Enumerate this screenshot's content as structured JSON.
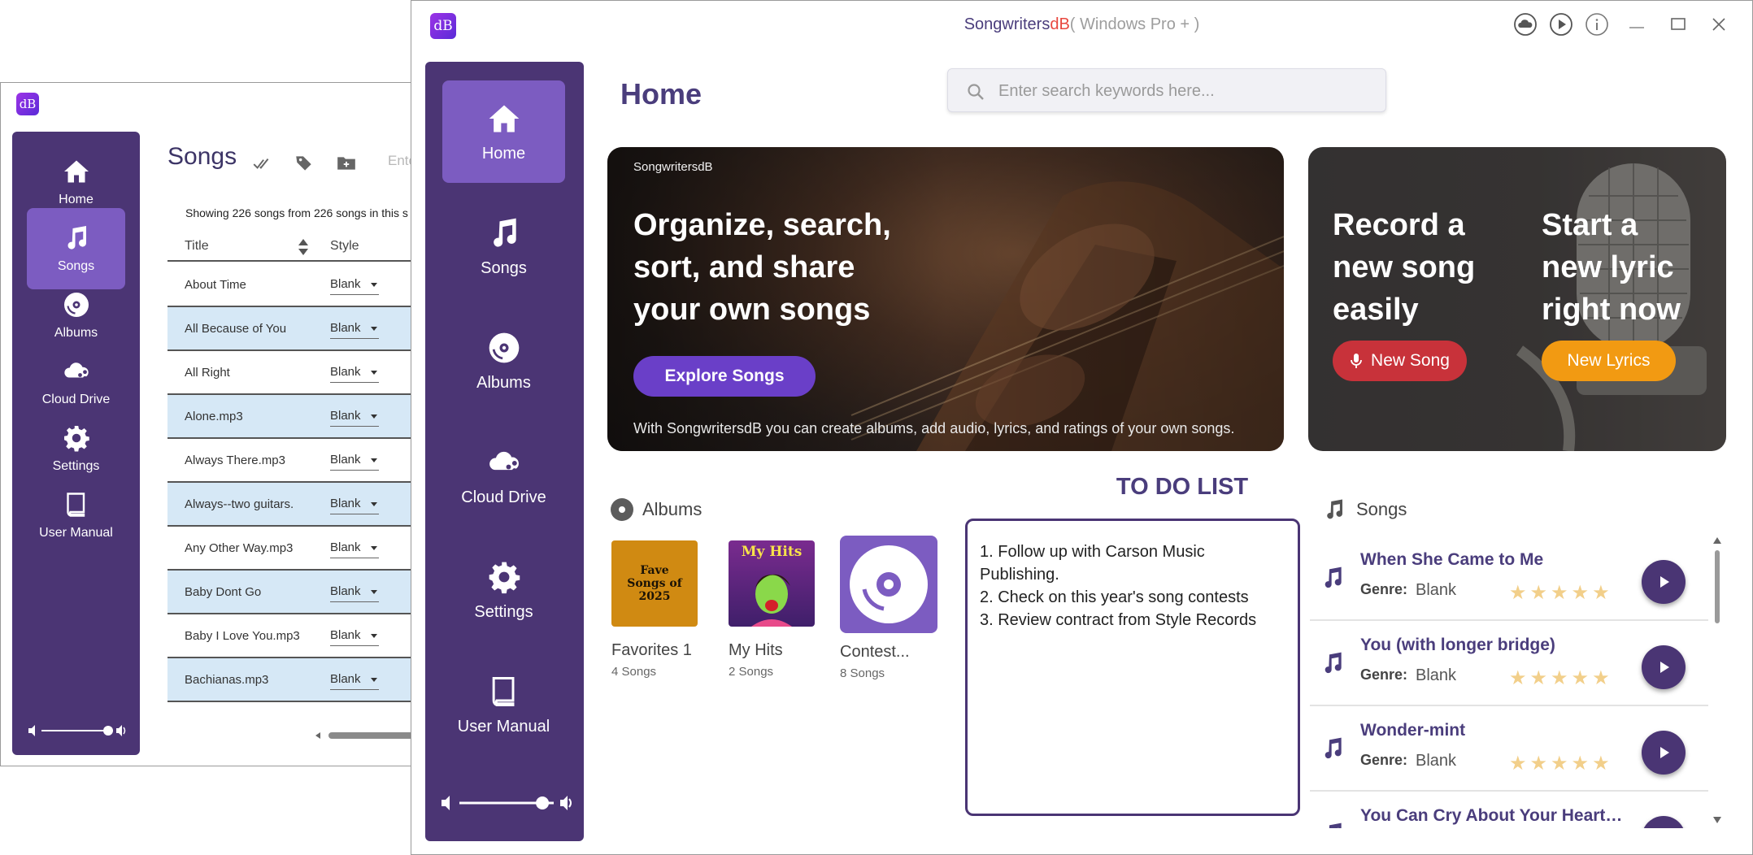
{
  "back_window": {
    "logo": "dB",
    "nav": [
      {
        "label": "Home",
        "icon": "home-icon"
      },
      {
        "label": "Songs",
        "icon": "music-note-icon"
      },
      {
        "label": "Albums",
        "icon": "disc-icon"
      },
      {
        "label": "Cloud Drive",
        "icon": "cloud-share-icon"
      },
      {
        "label": "Settings",
        "icon": "gear-icon"
      },
      {
        "label": "User Manual",
        "icon": "book-icon"
      }
    ],
    "active_nav": "Songs",
    "page_title": "Songs",
    "search_fragment": "Ente",
    "showing_text": "Showing 226 songs from 226 songs in this s",
    "columns": {
      "title": "Title",
      "style": "Style"
    },
    "rows": [
      {
        "title": "About Time",
        "style": "Blank"
      },
      {
        "title": "All Because of You",
        "style": "Blank"
      },
      {
        "title": "All Right",
        "style": "Blank"
      },
      {
        "title": "Alone.mp3",
        "style": "Blank"
      },
      {
        "title": "Always There.mp3",
        "style": "Blank"
      },
      {
        "title": "Always--two guitars.",
        "style": "Blank"
      },
      {
        "title": "Any Other Way.mp3",
        "style": "Blank"
      },
      {
        "title": "Baby Dont Go",
        "style": "Blank"
      },
      {
        "title": "Baby I Love You.mp3",
        "style": "Blank"
      },
      {
        "title": "Bachianas.mp3",
        "style": "Blank"
      }
    ]
  },
  "window": {
    "logo": "dB",
    "title_app": "Songwriters",
    "title_db": "dB",
    "title_edition": "( Windows Pro + )"
  },
  "sidebar": {
    "items": [
      {
        "label": "Home",
        "icon": "home-icon"
      },
      {
        "label": "Songs",
        "icon": "music-note-icon"
      },
      {
        "label": "Albums",
        "icon": "disc-icon"
      },
      {
        "label": "Cloud Drive",
        "icon": "cloud-share-icon"
      },
      {
        "label": "Settings",
        "icon": "gear-icon"
      },
      {
        "label": "User Manual",
        "icon": "book-icon"
      }
    ],
    "active": "Home",
    "volume_level": 0.88
  },
  "page_title": "Home",
  "search": {
    "placeholder": "Enter search keywords here..."
  },
  "hero": {
    "brand": "SongwritersdB",
    "heading": "Organize, search, sort, and share your own songs",
    "button": "Explore Songs",
    "footer": "With SongwritersdB you can create albums, add audio, lyrics, and ratings of your own songs."
  },
  "record": {
    "heading_left": "Record a new song easily",
    "heading_right": "Start a new lyric right now",
    "new_song_button": "New Song",
    "new_lyrics_button": "New Lyrics"
  },
  "albums": {
    "heading": "Albums",
    "items": [
      {
        "name": "Favorites 1",
        "count": "4 Songs",
        "cover_text": "Fave Songs of 2025"
      },
      {
        "name": "My Hits",
        "count": "2 Songs",
        "cover_text": "My Hits"
      },
      {
        "name": "Contest...",
        "count": "8 Songs"
      }
    ]
  },
  "todo": {
    "title": "TO DO LIST",
    "text": "1. Follow up with Carson Music Publishing.\n2. Check on this year's song contests\n3. Review contract from Style Records"
  },
  "songs": {
    "heading": "Songs",
    "genre_label": "Genre:",
    "items": [
      {
        "title": "When She Came to Me",
        "genre": "Blank",
        "rating": 0
      },
      {
        "title": "You (with longer bridge)",
        "genre": "Blank",
        "rating": 0
      },
      {
        "title": "Wonder-mint",
        "genre": "Blank",
        "rating": 0
      },
      {
        "title": "You Can Cry About Your Heartbr...",
        "genre": "",
        "rating": 0
      }
    ]
  },
  "colors": {
    "sidebar": "#4b3574",
    "sidebar_active": "#7c5cc1",
    "accent_purple": "#4a3d7c",
    "explore_button": "#6a3fc8",
    "new_song_button": "#c8323a",
    "new_lyrics_button": "#f29a12",
    "row_alt": "#d6e8f6",
    "star": "#f2cf8a"
  }
}
